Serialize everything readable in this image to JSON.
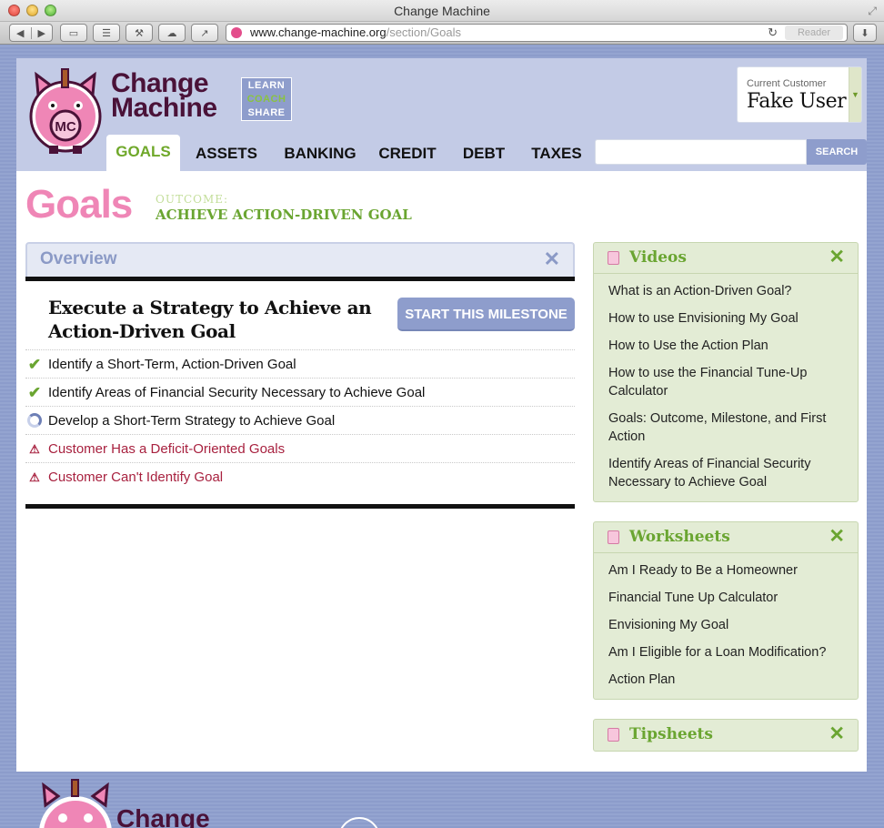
{
  "window": {
    "title": "Change Machine"
  },
  "browser": {
    "url_host": "www.change-machine.org",
    "url_path": "/section/Goals",
    "reader_label": "Reader"
  },
  "brand": {
    "line1": "Change",
    "line2": "Machine",
    "tags": [
      "LEARN",
      "COACH",
      "SHARE"
    ],
    "color": "#4a1238",
    "pink": "#ef86b6",
    "green": "#6aa531"
  },
  "customer": {
    "label": "Current Customer",
    "name": "Fake User"
  },
  "nav": {
    "tabs": [
      "GOALS",
      "ASSETS",
      "BANKING",
      "CREDIT",
      "DEBT",
      "TAXES"
    ],
    "active": "GOALS",
    "search_button": "SEARCH",
    "search_placeholder": ""
  },
  "page": {
    "title": "Goals",
    "outcome_label": "OUTCOME:",
    "outcome_value": "ACHIEVE ACTION-DRIVEN GOAL"
  },
  "overview": {
    "title": "Overview",
    "close": "✕",
    "milestone_title": "Execute a Strategy to Achieve an Action-Driven Goal",
    "start_button": "START THIS MILESTONE",
    "steps": [
      {
        "label": "Identify a Short-Term, Action-Driven Goal",
        "status": "done"
      },
      {
        "label": "Identify Areas of Financial Security Necessary to Achieve Goal",
        "status": "done"
      },
      {
        "label": "Develop a Short-Term Strategy to Achieve Goal",
        "status": "in-progress"
      },
      {
        "label": "Customer Has a Deficit-Oriented Goals",
        "status": "alert"
      },
      {
        "label": "Customer Can't Identify Goal",
        "status": "alert"
      }
    ]
  },
  "sidebar": {
    "videos": {
      "title": "Videos",
      "items": [
        "What is an Action-Driven Goal?",
        "How to use Envisioning My Goal",
        "How to Use the Action Plan",
        "How to use the Financial Tune-Up Calculator",
        "Goals: Outcome, Milestone, and First Action",
        "Identify Areas of Financial Security Necessary to Achieve Goal"
      ]
    },
    "worksheets": {
      "title": "Worksheets",
      "items": [
        "Am I Ready to Be a Homeowner",
        "Financial Tune Up Calculator",
        "Envisioning My Goal",
        "Am I Eligible for a Loan Modification?",
        "Action Plan"
      ]
    },
    "tipsheets": {
      "title": "Tipsheets",
      "items": []
    }
  },
  "footer": {
    "brand_partial": "Change"
  }
}
